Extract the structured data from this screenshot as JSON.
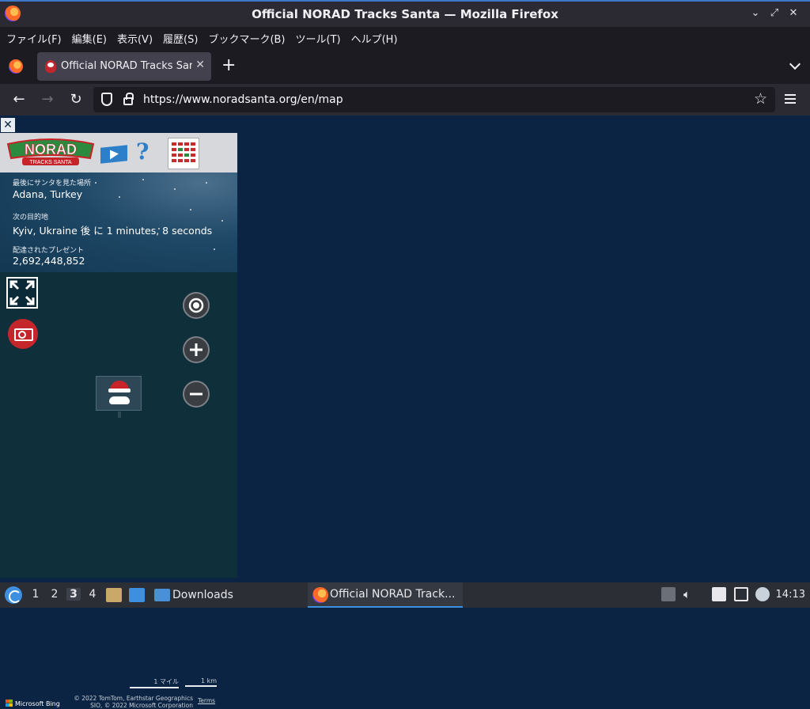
{
  "window": {
    "title": "Official NORAD Tracks Santa — Mozilla Firefox"
  },
  "menu": {
    "items": [
      "ファイル(F)",
      "編集(E)",
      "表示(V)",
      "履歴(S)",
      "ブックマーク(B)",
      "ツール(T)",
      "ヘルプ(H)"
    ]
  },
  "tab": {
    "title": "Official NORAD Tracks Santa",
    "close_glyph": "✕",
    "new_tab_glyph": "+"
  },
  "nav": {
    "url": "https://www.noradsanta.org/en/map"
  },
  "tracker": {
    "logo_text": "NORAD",
    "logo_subtext": "TRACKS SANTA",
    "close_glyph": "✕",
    "help_glyph": "?",
    "last_seen_label": "最後にサンタを見た場所",
    "last_seen_value": "Adana, Turkey",
    "next_stop_label": "次の目的地",
    "next_stop_value": "Kyiv, Ukraine 後 に 1 minutes, 8 seconds",
    "gifts_label": "配達されたプレゼント",
    "gifts_value": "2,692,448,852"
  },
  "map": {
    "scale_miles": "1 マイル",
    "scale_km": "1 km",
    "bing_label": "Microsoft Bing",
    "copyright_line1": "© 2022 TomTom, Earthstar Geographics",
    "copyright_line2": "SIO, © 2022 Microsoft Corporation",
    "terms": "Terms"
  },
  "taskbar": {
    "workspaces": [
      "1",
      "2",
      "3",
      "4"
    ],
    "active_workspace": "3",
    "downloads_label": "Downloads",
    "window_label": "Official NORAD Track...",
    "clock": "14:13"
  }
}
